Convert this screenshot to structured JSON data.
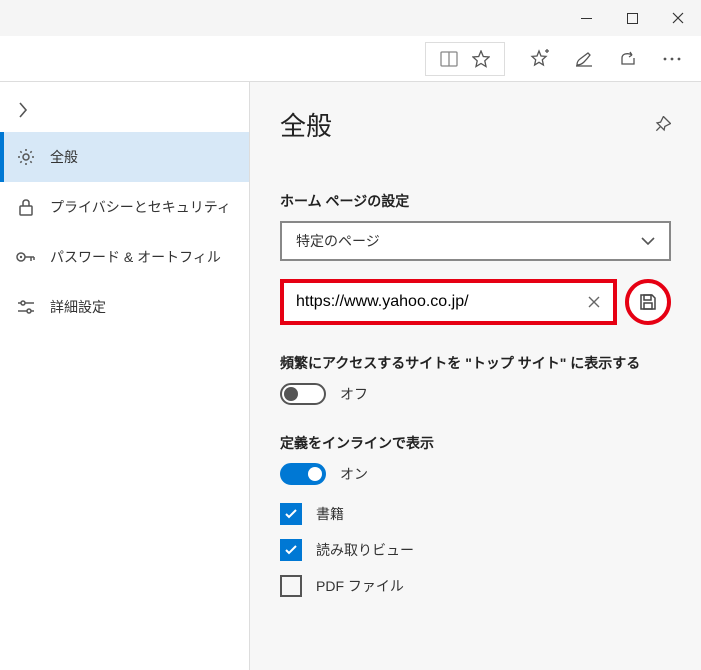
{
  "sidebar": {
    "items": [
      {
        "label": "全般"
      },
      {
        "label": "プライバシーとセキュリティ"
      },
      {
        "label": "パスワード & オートフィル"
      },
      {
        "label": "詳細設定"
      }
    ]
  },
  "content": {
    "title": "全般",
    "homepage": {
      "label": "ホーム ページの設定",
      "dropdown_value": "特定のページ",
      "url_value": "https://www.yahoo.co.jp/"
    },
    "topsites": {
      "label": "頻繁にアクセスするサイトを \"トップ サイト\" に表示する",
      "state_label": "オフ"
    },
    "inline_def": {
      "label": "定義をインラインで表示",
      "state_label": "オン",
      "checks": [
        {
          "label": "書籍",
          "checked": true
        },
        {
          "label": "読み取りビュー",
          "checked": true
        },
        {
          "label": "PDF ファイル",
          "checked": false
        }
      ]
    }
  }
}
